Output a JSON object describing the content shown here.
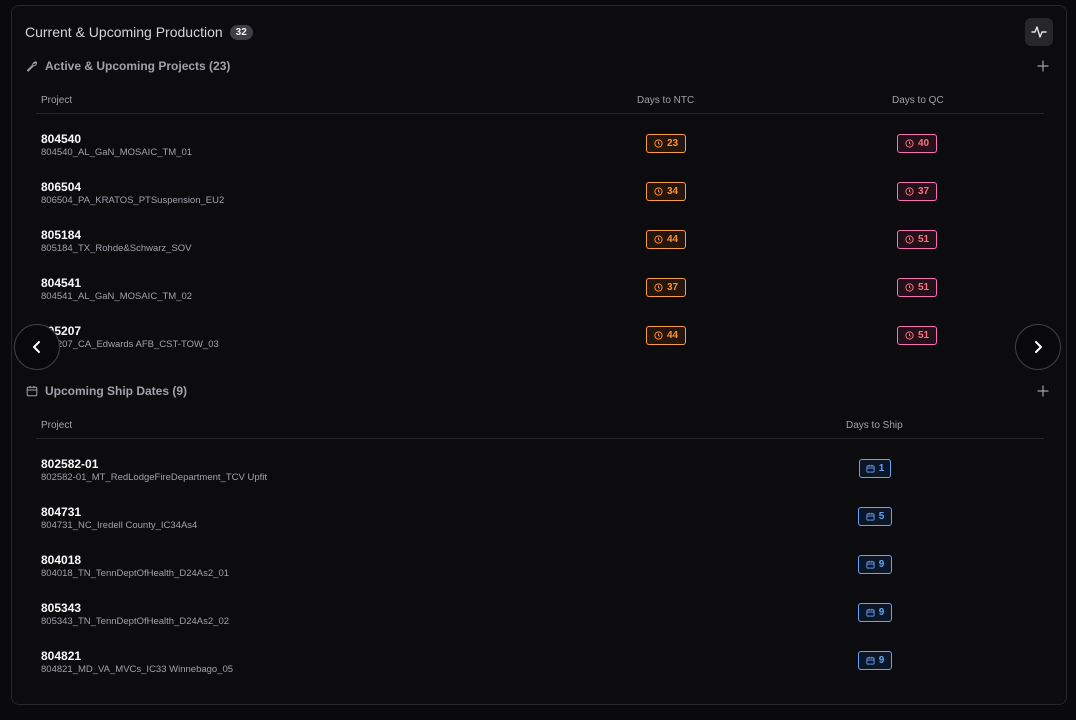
{
  "header": {
    "title": "Current & Upcoming Production",
    "count": "32"
  },
  "active": {
    "title": "Active & Upcoming Projects (23)",
    "col_project": "Project",
    "col_ntc": "Days to NTC",
    "col_qc": "Days to QC",
    "rows": [
      {
        "id": "804540",
        "name": "804540_AL_GaN_MOSAIC_TM_01",
        "ntc": "23",
        "qc": "40"
      },
      {
        "id": "806504",
        "name": "806504_PA_KRATOS_PTSuspension_EU2",
        "ntc": "34",
        "qc": "37"
      },
      {
        "id": "805184",
        "name": "805184_TX_Rohde&Schwarz_SOV",
        "ntc": "44",
        "qc": "51"
      },
      {
        "id": "804541",
        "name": "804541_AL_GaN_MOSAIC_TM_02",
        "ntc": "37",
        "qc": "51"
      },
      {
        "id": "805207",
        "name": "805207_CA_Edwards AFB_CST-TOW_03",
        "ntc": "44",
        "qc": "51"
      }
    ]
  },
  "ship": {
    "title": "Upcoming Ship Dates (9)",
    "col_project": "Project",
    "col_days": "Days to Ship",
    "rows": [
      {
        "id": "802582-01",
        "name": "802582-01_MT_RedLodgeFireDepartment_TCV Upfit",
        "days": "1"
      },
      {
        "id": "804731",
        "name": "804731_NC_Iredell County_IC34As4",
        "days": "5"
      },
      {
        "id": "804018",
        "name": "804018_TN_TennDeptOfHealth_D24As2_01",
        "days": "9"
      },
      {
        "id": "805343",
        "name": "805343_TN_TennDeptOfHealth_D24As2_02",
        "days": "9"
      },
      {
        "id": "804821",
        "name": "804821_MD_VA_MVCs_IC33 Winnebago_05",
        "days": "9"
      }
    ]
  },
  "icons": {
    "activity": "activity-icon",
    "wrench": "wrench-icon",
    "calendar": "calendar-icon",
    "clock": "clock-icon",
    "plus": "plus-icon",
    "prev": "chevron-left-icon",
    "next": "chevron-right-icon"
  },
  "colors": {
    "ntc": "#fb923c",
    "qc": "#fb7185",
    "ship": "#60a5fa",
    "background": "#0a0a0c"
  }
}
